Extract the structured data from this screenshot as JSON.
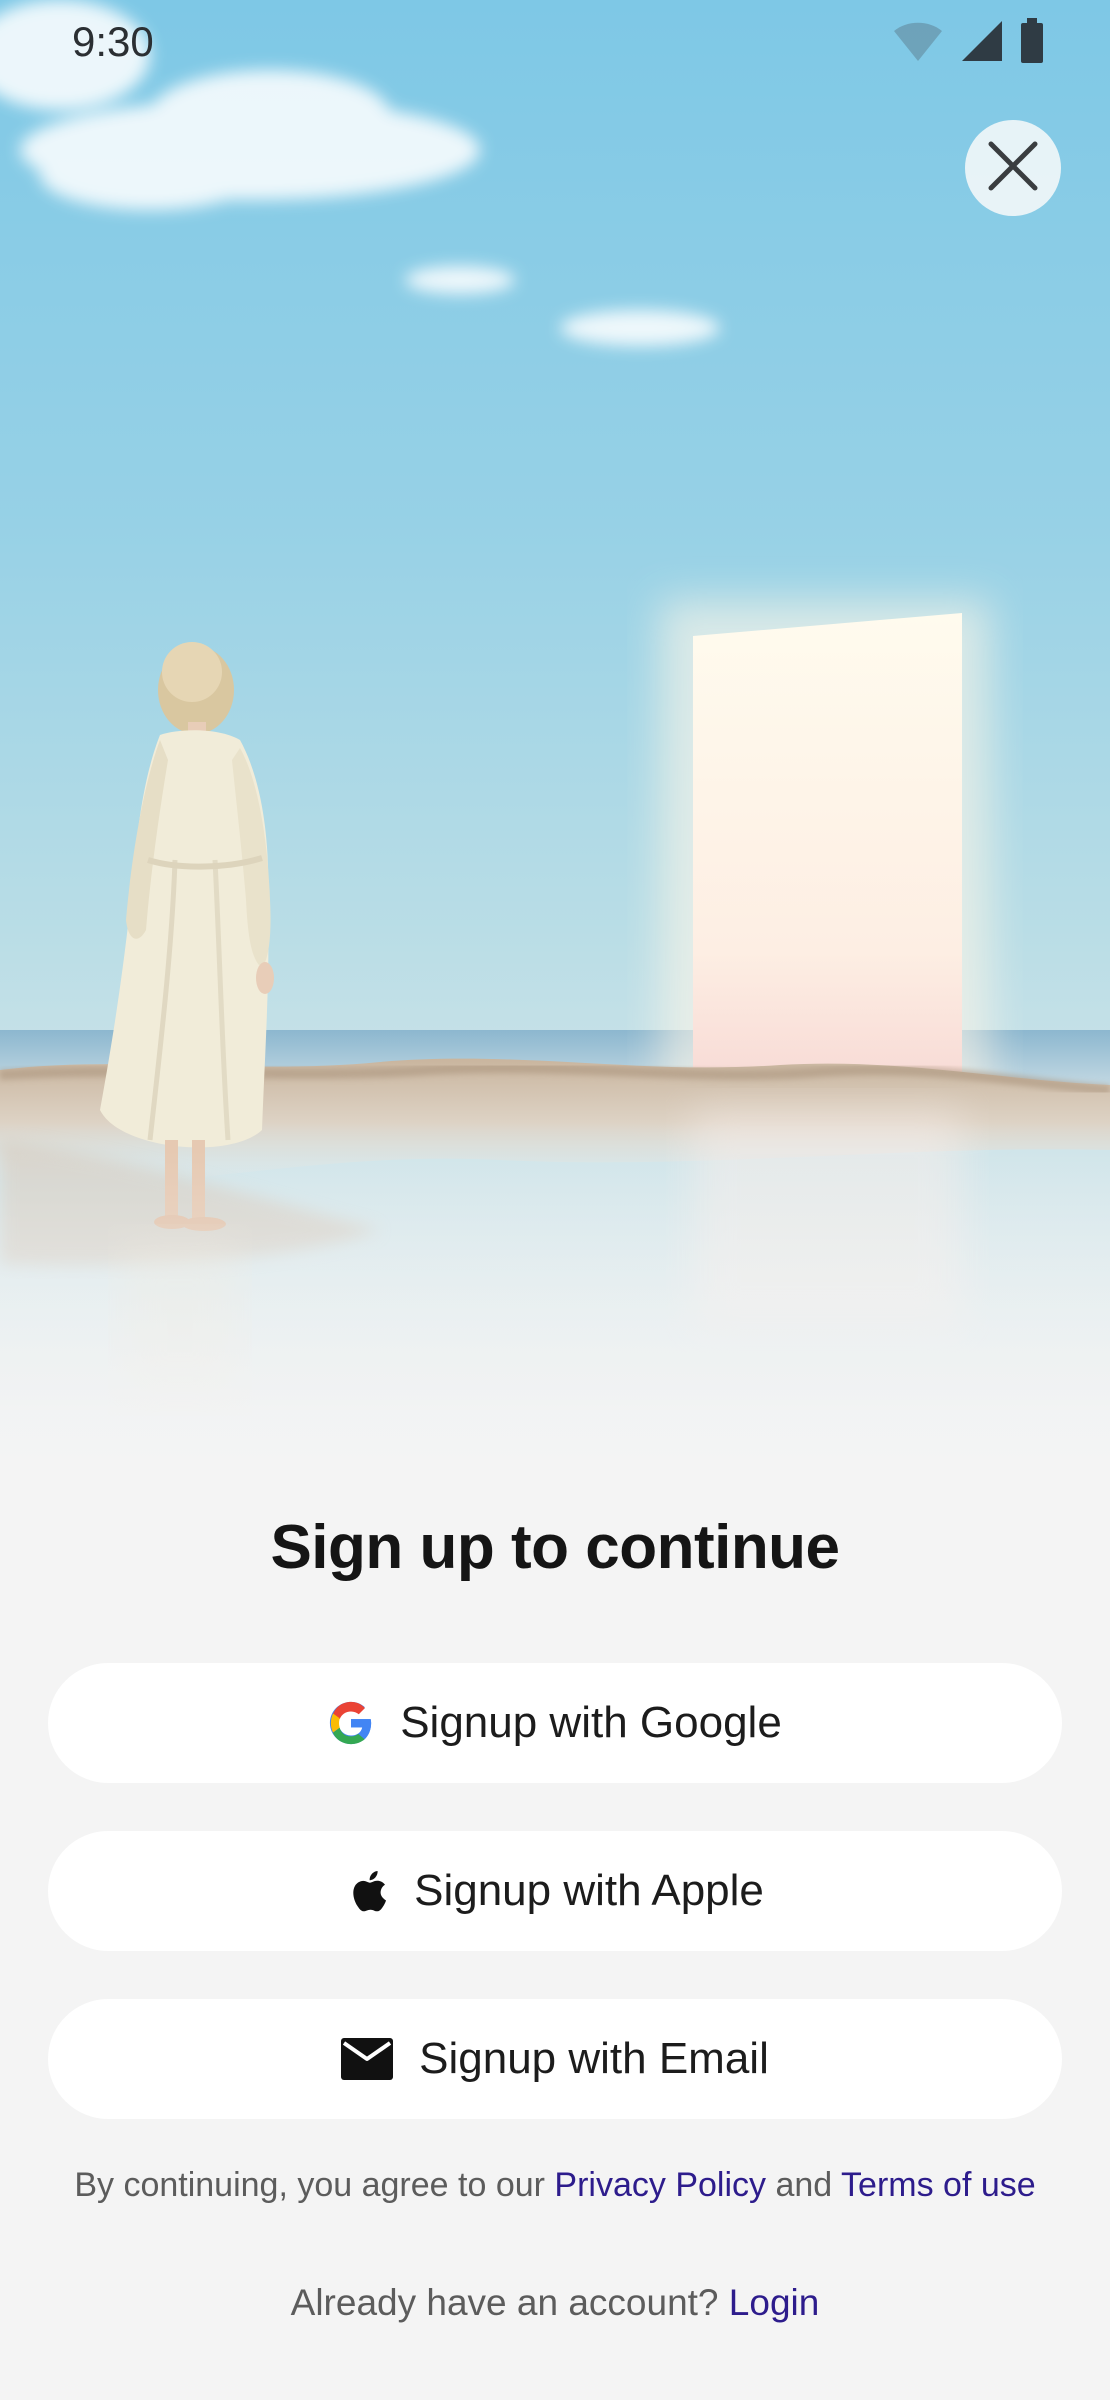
{
  "status_bar": {
    "time": "9:30",
    "icons": [
      "wifi-icon",
      "cell-signal-icon",
      "battery-icon"
    ]
  },
  "close_icon": "close-icon",
  "title": "Sign up to continue",
  "buttons": {
    "google": {
      "label": "Signup with Google",
      "icon": "google-logo-icon"
    },
    "apple": {
      "label": "Signup with Apple",
      "icon": "apple-logo-icon"
    },
    "email": {
      "label": "Signup with Email",
      "icon": "mail-icon"
    }
  },
  "terms": {
    "prefix": "By continuing, you agree to our ",
    "privacy_link": "Privacy Policy",
    "connector": " and ",
    "terms_link": "Terms of use"
  },
  "login": {
    "prompt": "Already have an account? ",
    "link": "Login"
  },
  "colors": {
    "background": "#f4f4f4",
    "button_bg": "#ffffff",
    "link": "#2d1c8c",
    "sky": "#7cc7e4"
  }
}
